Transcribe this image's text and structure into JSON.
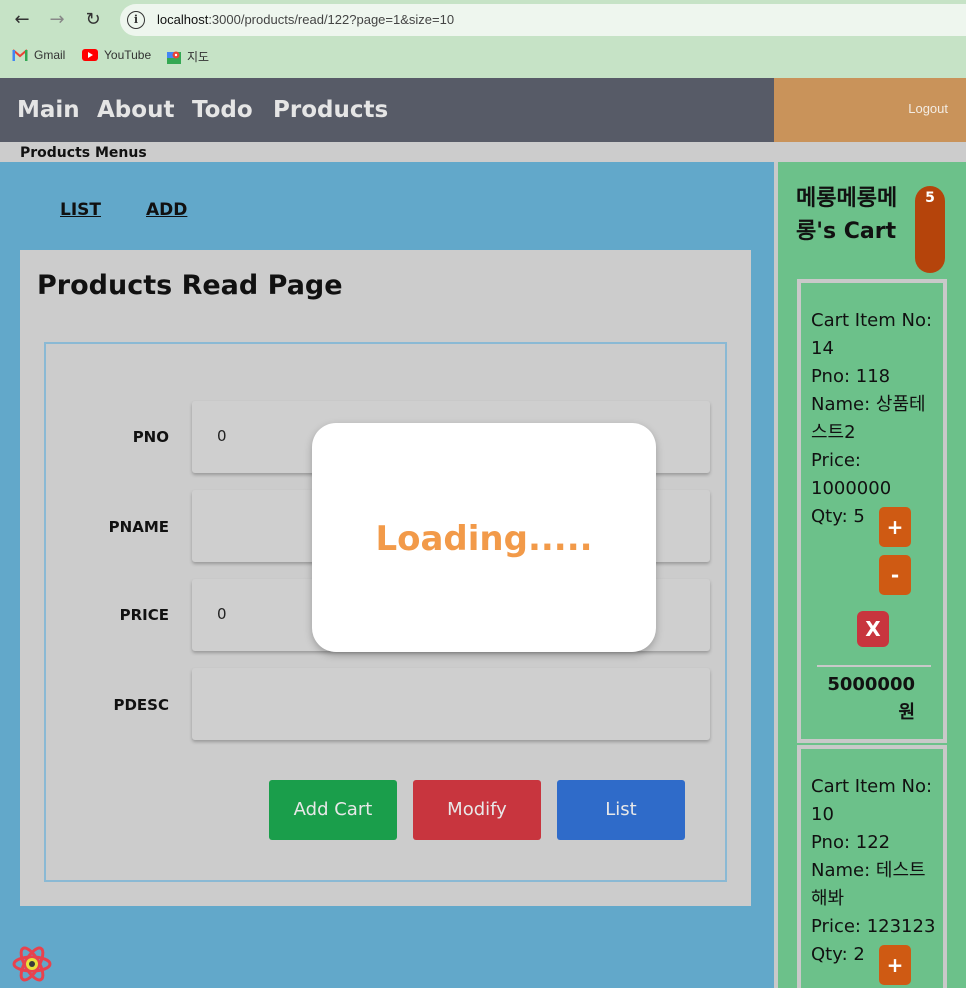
{
  "browser": {
    "url_host": "localhost",
    "url_rest": ":3000/products/read/122?page=1&size=10",
    "bookmarks": [
      {
        "label": "Gmail",
        "icon": "gmail-icon"
      },
      {
        "label": "YouTube",
        "icon": "youtube-icon"
      },
      {
        "label": "지도",
        "icon": "maps-icon"
      }
    ]
  },
  "nav": {
    "items": [
      "Main",
      "About",
      "Todo",
      "Products"
    ],
    "logout": "Logout"
  },
  "submenu": {
    "title": "Products Menus",
    "links": [
      "LIST",
      "ADD"
    ]
  },
  "read": {
    "title": "Products Read Page",
    "fields": [
      {
        "label": "PNO",
        "value": "0"
      },
      {
        "label": "PNAME",
        "value": ""
      },
      {
        "label": "PRICE",
        "value": "0"
      },
      {
        "label": "PDESC",
        "value": ""
      }
    ],
    "buttons": {
      "add_cart": "Add Cart",
      "modify": "Modify",
      "list": "List"
    }
  },
  "modal": {
    "text": "Loading....."
  },
  "cart": {
    "owner": "메롱메롱메롱's Cart",
    "count": "5",
    "items": [
      {
        "item_no": "Cart Item No: 14",
        "pno": "Pno: 118",
        "name": "Name: 상품테스트2",
        "price": "Price: 1000000",
        "qty": "Qty: 5",
        "plus": "+",
        "minus": "-",
        "delete": "X",
        "total": "5000000 원"
      },
      {
        "item_no": "Cart Item No: 10",
        "pno": "Pno: 122",
        "name": "Name: 테스트해봐",
        "price": "Price: 123123",
        "qty": "Qty: 2",
        "plus": "+"
      }
    ]
  },
  "colors": {
    "page_bg": "#62a8ca",
    "nav_bg": "#575b67",
    "logout_bg": "#c9935a",
    "cart_bg": "#6cc18a",
    "add_cart": "#1a9e4b",
    "modify": "#c8353e",
    "list": "#2f6bc9",
    "loading_text": "#f29a49"
  }
}
